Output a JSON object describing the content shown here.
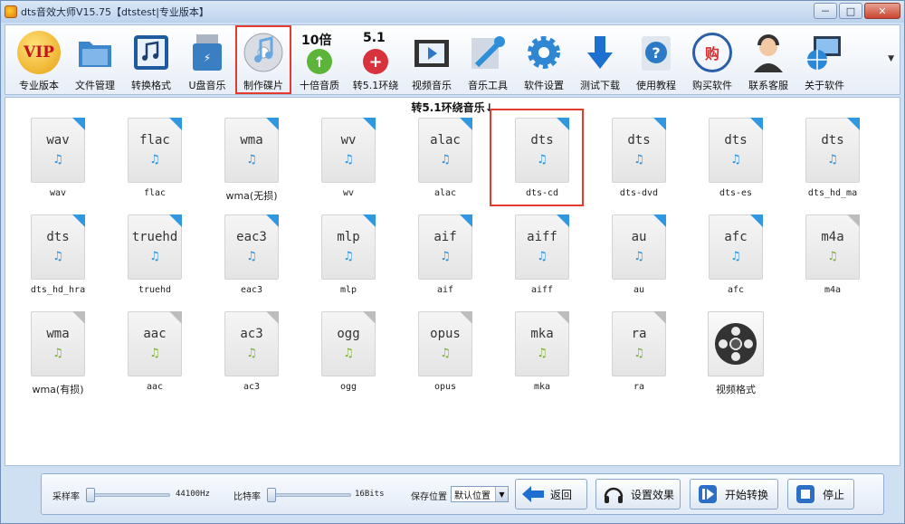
{
  "window": {
    "title": "dts音效大师V15.75【dtstest|专业版本】",
    "buttons": {
      "minimize": "－",
      "maximize": "□",
      "close": "✕"
    }
  },
  "toolbar": {
    "items": [
      {
        "label": "专业版本",
        "icon": "vip-icon",
        "icon_text": "VIP",
        "color": "#e8a011"
      },
      {
        "label": "文件管理",
        "icon": "folder-icon",
        "color": "#3c86c9"
      },
      {
        "label": "转换格式",
        "icon": "music-convert-icon",
        "color": "#1f5a9e"
      },
      {
        "label": "U盘音乐",
        "icon": "usb-drive-icon",
        "color": "#3a7fc2"
      },
      {
        "label": "制作碟片",
        "icon": "disc-music-icon",
        "color": "#6aa7e0"
      },
      {
        "label": "十倍音质",
        "icon": "ten-times-icon",
        "icon_text": "10倍",
        "color": "#5cb53a"
      },
      {
        "label": "转5.1环绕",
        "icon": "surround-51-icon",
        "icon_text": "5.1",
        "color": "#d8323c"
      },
      {
        "label": "视频音乐",
        "icon": "video-film-icon",
        "color": "#2b76c9"
      },
      {
        "label": "音乐工具",
        "icon": "tools-icon",
        "color": "#2c8fd8"
      },
      {
        "label": "软件设置",
        "icon": "gear-icon",
        "color": "#2f87d4"
      },
      {
        "label": "测试下载",
        "icon": "download-arrow-icon",
        "color": "#1d6fd0"
      },
      {
        "label": "使用教程",
        "icon": "help-icon",
        "color": "#2c7ac6"
      },
      {
        "label": "购买软件",
        "icon": "buy-icon",
        "icon_text": "购",
        "color": "#d53030"
      },
      {
        "label": "联系客服",
        "icon": "customer-service-icon",
        "color": "#333333"
      },
      {
        "label": "关于软件",
        "icon": "computer-globe-icon",
        "color": "#2b88d6"
      }
    ]
  },
  "main": {
    "section_title": "转5.1环绕音乐↓",
    "files": [
      {
        "ext": "wav",
        "caption": "wav",
        "style": "blue"
      },
      {
        "ext": "flac",
        "caption": "flac",
        "style": "blue"
      },
      {
        "ext": "wma",
        "caption": "wma(无损)",
        "style": "blue"
      },
      {
        "ext": "wv",
        "caption": "wv",
        "style": "blue"
      },
      {
        "ext": "alac",
        "caption": "alac",
        "style": "blue"
      },
      {
        "ext": "dts",
        "caption": "dts-cd",
        "style": "blue"
      },
      {
        "ext": "dts",
        "caption": "dts-dvd",
        "style": "blue"
      },
      {
        "ext": "dts",
        "caption": "dts-es",
        "style": "blue"
      },
      {
        "ext": "dts",
        "caption": "dts_hd_ma",
        "style": "blue"
      },
      {
        "ext": "dts",
        "caption": "dts_hd_hra",
        "style": "blue"
      },
      {
        "ext": "truehd",
        "caption": "truehd",
        "style": "blue"
      },
      {
        "ext": "eac3",
        "caption": "eac3",
        "style": "blue"
      },
      {
        "ext": "mlp",
        "caption": "mlp",
        "style": "blue"
      },
      {
        "ext": "aif",
        "caption": "aif",
        "style": "blue"
      },
      {
        "ext": "aiff",
        "caption": "aiff",
        "style": "blue"
      },
      {
        "ext": "au",
        "caption": "au",
        "style": "blue"
      },
      {
        "ext": "afc",
        "caption": "afc",
        "style": "blue"
      },
      {
        "ext": "m4a",
        "caption": "m4a",
        "style": "green"
      },
      {
        "ext": "wma",
        "caption": "wma(有损)",
        "style": "green"
      },
      {
        "ext": "aac",
        "caption": "aac",
        "style": "green"
      },
      {
        "ext": "ac3",
        "caption": "ac3",
        "style": "green"
      },
      {
        "ext": "ogg",
        "caption": "ogg",
        "style": "green"
      },
      {
        "ext": "opus",
        "caption": "opus",
        "style": "green"
      },
      {
        "ext": "mka",
        "caption": "mka",
        "style": "green"
      },
      {
        "ext": "ra",
        "caption": "ra",
        "style": "green"
      },
      {
        "ext": "",
        "caption": "视频格式",
        "style": "video"
      }
    ]
  },
  "bottom": {
    "sample_rate_label": "采样率",
    "sample_rate_value": "44100Hz",
    "bit_rate_label": "比特率",
    "bit_rate_value": "16Bits",
    "save_location_label": "保存位置",
    "save_location_selected": "默认位置",
    "back_button": "返回",
    "effects_button": "设置效果",
    "start_button": "开始转换",
    "stop_button": "停止"
  },
  "colors": {
    "highlight": "#e53b2f",
    "accent": "#2f98e0"
  }
}
